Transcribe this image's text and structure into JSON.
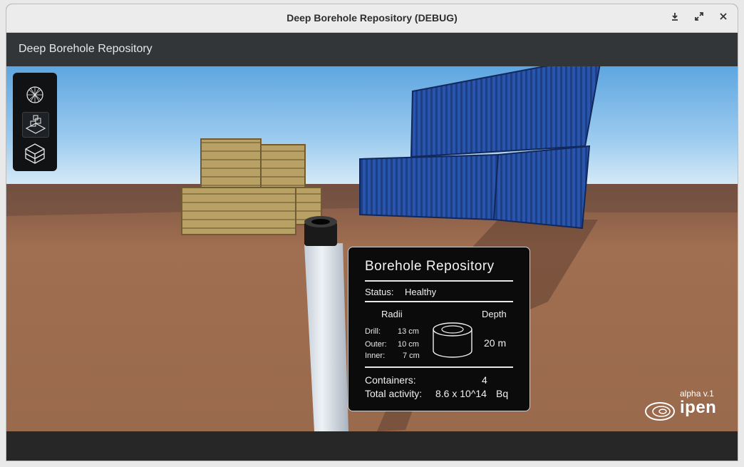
{
  "window": {
    "title": "Deep Borehole Repository (DEBUG)",
    "controls": {
      "download_icon": "download-icon",
      "maximize_icon": "maximize-icon",
      "close_icon": "close-icon"
    }
  },
  "appbar": {
    "title": "Deep Borehole Repository"
  },
  "toolbox": {
    "tools": [
      {
        "icon": "geodesic-sphere-icon",
        "active": false
      },
      {
        "icon": "stacked-boxes-icon",
        "active": true
      },
      {
        "icon": "cube-icon",
        "active": false
      }
    ]
  },
  "panel": {
    "title": "Borehole Repository",
    "status_label": "Status:",
    "status_value": "Healthy",
    "radii_header": "Radii",
    "depth_header": "Depth",
    "drill_label": "Drill:",
    "drill_value": "13 cm",
    "outer_label": "Outer:",
    "outer_value": "10 cm",
    "inner_label": "Inner:",
    "inner_value": "7 cm",
    "depth_value": "20 m",
    "containers_label": "Containers:",
    "containers_value": "4",
    "activity_label": "Total activity:",
    "activity_value": "8.6 x 10^14",
    "activity_unit": "Bq"
  },
  "branding": {
    "version": "alpha v.1",
    "logo_text": "ipen"
  },
  "colors": {
    "sky_top": "#6fb3e8",
    "ground": "#9b6a4d",
    "container_blue": "#2a56b0",
    "crate": "#b79e62"
  }
}
